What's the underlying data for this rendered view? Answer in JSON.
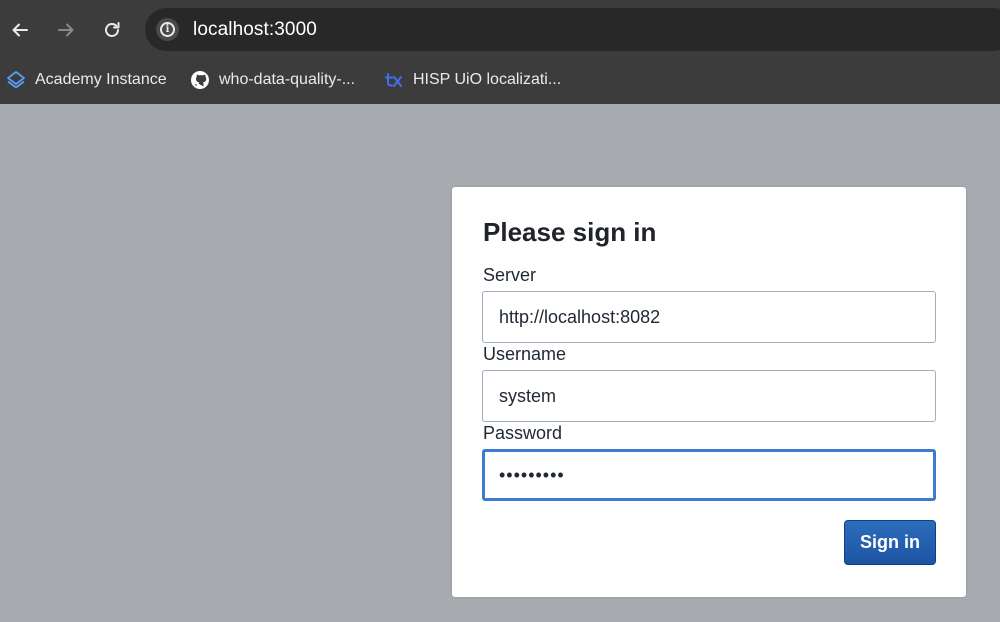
{
  "browser": {
    "url": "localhost:3000",
    "bookmarks": [
      {
        "label": "Academy Instance",
        "icon": "layers-icon"
      },
      {
        "label": "who-data-quality-...",
        "icon": "github-icon"
      },
      {
        "label": "HISP UiO localizati...",
        "icon": "transifex-icon"
      }
    ]
  },
  "login": {
    "title": "Please sign in",
    "server_label": "Server",
    "server_value": "http://localhost:8082",
    "username_label": "Username",
    "username_value": "system",
    "password_label": "Password",
    "password_value": "•••••••••",
    "submit_label": "Sign in"
  },
  "colors": {
    "toolbar": "#3c3c3c",
    "page_background": "#a7aaae",
    "primary": "#1d55a3",
    "focus": "#3b7cd0"
  }
}
